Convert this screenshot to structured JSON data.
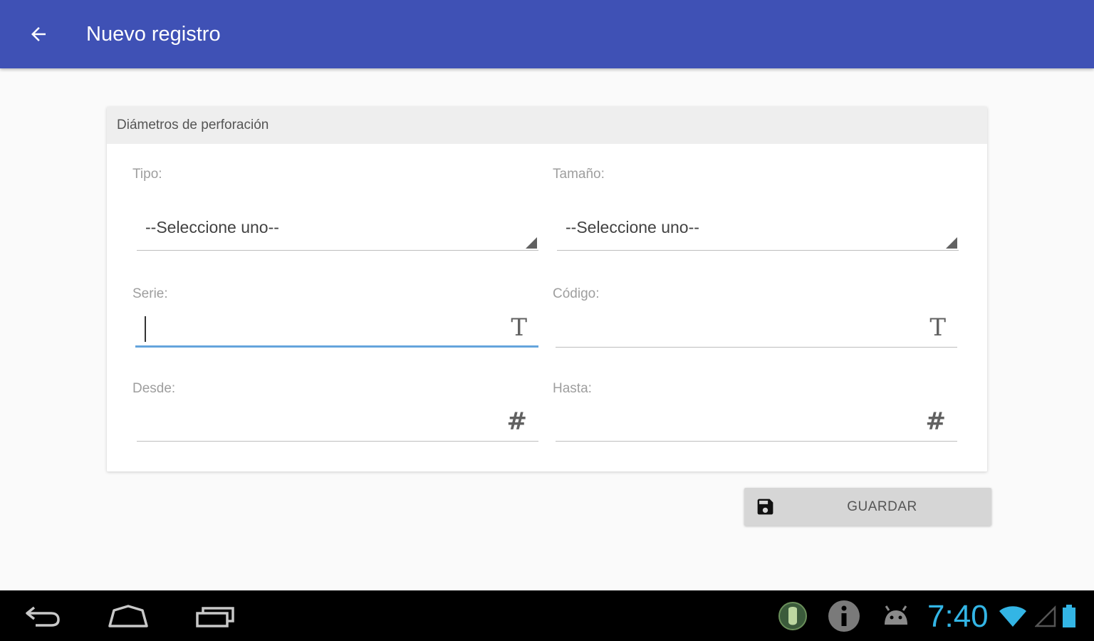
{
  "appbar": {
    "title": "Nuevo registro",
    "color": "#3f51b5"
  },
  "card": {
    "header_title": "Diámetros de perforación",
    "fields": {
      "tipo": {
        "label": "Tipo:",
        "value": "--Seleccione uno--"
      },
      "tamano": {
        "label": "Tamaño:",
        "value": "--Seleccione uno--"
      },
      "serie": {
        "label": "Serie:",
        "value": "",
        "icon": "text-type-icon",
        "icon_glyph": "T"
      },
      "codigo": {
        "label": "Código:",
        "value": "",
        "icon": "text-type-icon",
        "icon_glyph": "T"
      },
      "desde": {
        "label": "Desde:",
        "value": "",
        "icon": "number-type-icon",
        "icon_glyph": "#"
      },
      "hasta": {
        "label": "Hasta:",
        "value": "",
        "icon": "number-type-icon",
        "icon_glyph": "#"
      }
    }
  },
  "actions": {
    "save_label": "GUARDAR",
    "save_icon": "floppy-disk-icon"
  },
  "system_bar": {
    "time": "7:40",
    "time_color": "#33b5e5",
    "icons": [
      "back-icon",
      "home-icon",
      "recent-apps-icon",
      "notification-app-icon",
      "info-icon",
      "android-debug-icon",
      "wifi-icon",
      "cell-signal-icon",
      "battery-icon"
    ]
  }
}
